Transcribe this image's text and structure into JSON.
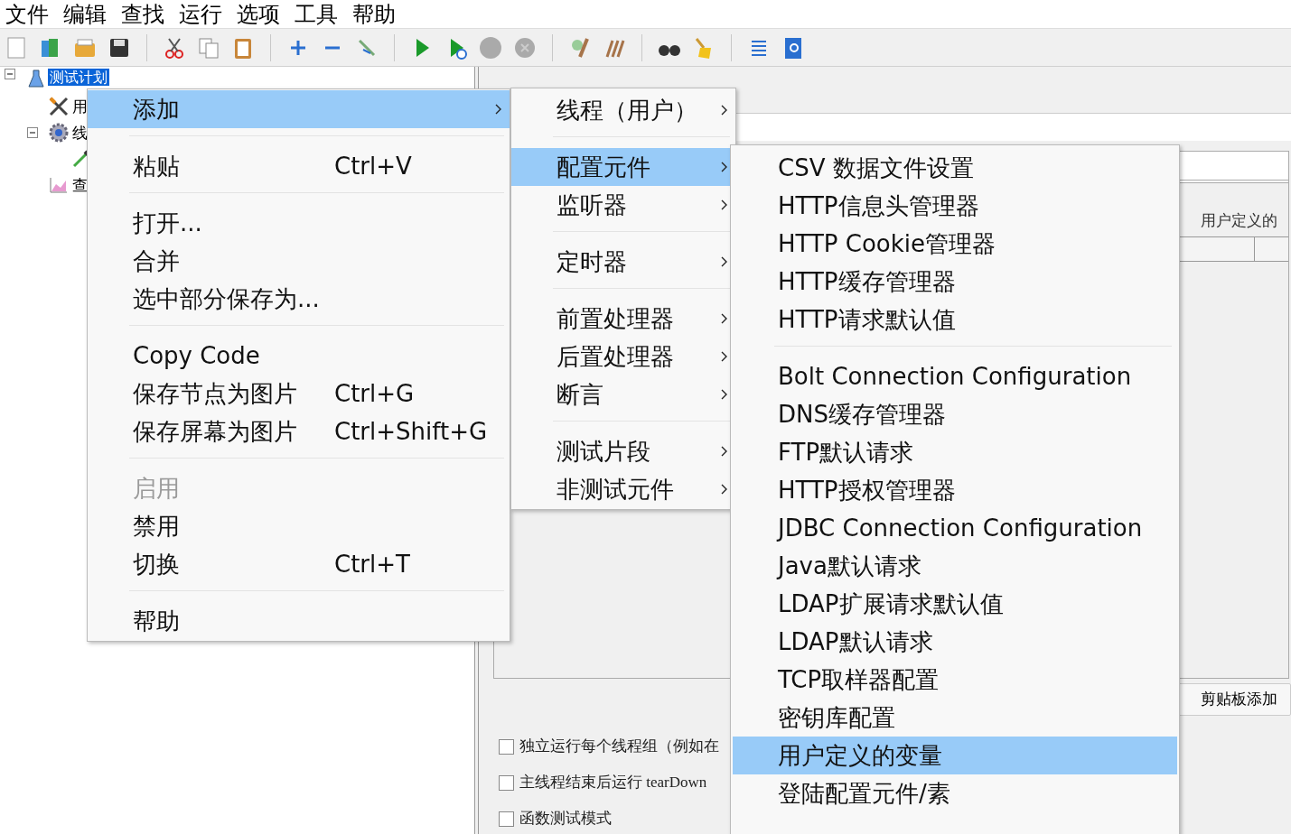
{
  "menubar": [
    {
      "label": "文件"
    },
    {
      "label": "编辑"
    },
    {
      "label": "查找"
    },
    {
      "label": "运行"
    },
    {
      "label": "选项"
    },
    {
      "label": "工具"
    },
    {
      "label": "帮助"
    }
  ],
  "tree": {
    "label": "测试计划",
    "kind": "plan",
    "selected": true,
    "expanded": true,
    "children": [
      {
        "label": "用",
        "kind": "config",
        "selected": false
      },
      {
        "label": "线",
        "kind": "thread_group",
        "selected": false,
        "expanded": true,
        "children": [
          {
            "kind": "sampler"
          }
        ]
      },
      {
        "label": "查",
        "kind": "listener",
        "selected": false
      }
    ]
  },
  "right_panel": {
    "table_header": "用户定义的",
    "clipboard_button": "剪贴板添加",
    "checkboxes": [
      {
        "label": "独立运行每个线程组（例如在",
        "checked": false
      },
      {
        "label": "主线程结束后运行 tearDown",
        "checked": false
      },
      {
        "label": "函数测试模式",
        "checked": false
      }
    ]
  },
  "context_menu": {
    "items": [
      {
        "kind": "item",
        "label": "添加",
        "selected": true,
        "submenu": true,
        "disabled": false
      },
      {
        "kind": "separator"
      },
      {
        "kind": "item",
        "label": "粘贴",
        "shortcut": "Ctrl+V",
        "selected": false,
        "submenu": false,
        "disabled": false
      },
      {
        "kind": "separator"
      },
      {
        "kind": "item",
        "label": "打开...",
        "selected": false,
        "submenu": false,
        "disabled": false
      },
      {
        "kind": "item",
        "label": "合并",
        "selected": false,
        "submenu": false,
        "disabled": false
      },
      {
        "kind": "item",
        "label": "选中部分保存为...",
        "selected": false,
        "submenu": false,
        "disabled": false
      },
      {
        "kind": "separator"
      },
      {
        "kind": "item",
        "label": "Copy Code",
        "selected": false,
        "submenu": false,
        "disabled": false
      },
      {
        "kind": "item",
        "label": "保存节点为图片",
        "shortcut": "Ctrl+G",
        "selected": false,
        "submenu": false,
        "disabled": false
      },
      {
        "kind": "item",
        "label": "保存屏幕为图片",
        "shortcut": "Ctrl+Shift+G",
        "selected": false,
        "submenu": false,
        "disabled": false
      },
      {
        "kind": "separator"
      },
      {
        "kind": "item",
        "label": "启用",
        "selected": false,
        "submenu": false,
        "disabled": true
      },
      {
        "kind": "item",
        "label": "禁用",
        "selected": false,
        "submenu": false,
        "disabled": false
      },
      {
        "kind": "item",
        "label": "切换",
        "shortcut": "Ctrl+T",
        "selected": false,
        "submenu": false,
        "disabled": false
      },
      {
        "kind": "separator"
      },
      {
        "kind": "item",
        "label": "帮助",
        "selected": false,
        "submenu": false,
        "disabled": false
      }
    ]
  },
  "add_submenu": {
    "items": [
      {
        "kind": "item",
        "label": "线程（用户）",
        "selected": false,
        "submenu": true
      },
      {
        "kind": "separator"
      },
      {
        "kind": "item",
        "label": "配置元件",
        "selected": true,
        "submenu": true
      },
      {
        "kind": "item",
        "label": "监听器",
        "selected": false,
        "submenu": true
      },
      {
        "kind": "separator"
      },
      {
        "kind": "item",
        "label": "定时器",
        "selected": false,
        "submenu": true
      },
      {
        "kind": "separator"
      },
      {
        "kind": "item",
        "label": "前置处理器",
        "selected": false,
        "submenu": true
      },
      {
        "kind": "item",
        "label": "后置处理器",
        "selected": false,
        "submenu": true
      },
      {
        "kind": "item",
        "label": "断言",
        "selected": false,
        "submenu": true
      },
      {
        "kind": "separator"
      },
      {
        "kind": "item",
        "label": "测试片段",
        "selected": false,
        "submenu": true
      },
      {
        "kind": "item",
        "label": "非测试元件",
        "selected": false,
        "submenu": true
      }
    ]
  },
  "config_submenu": {
    "items": [
      {
        "kind": "item",
        "label": "CSV 数据文件设置",
        "selected": false
      },
      {
        "kind": "item",
        "label": "HTTP信息头管理器",
        "selected": false
      },
      {
        "kind": "item",
        "label": "HTTP Cookie管理器",
        "selected": false
      },
      {
        "kind": "item",
        "label": "HTTP缓存管理器",
        "selected": false
      },
      {
        "kind": "item",
        "label": "HTTP请求默认值",
        "selected": false
      },
      {
        "kind": "separator"
      },
      {
        "kind": "item",
        "label": "Bolt Connection Configuration",
        "selected": false
      },
      {
        "kind": "item",
        "label": "DNS缓存管理器",
        "selected": false
      },
      {
        "kind": "item",
        "label": "FTP默认请求",
        "selected": false
      },
      {
        "kind": "item",
        "label": "HTTP授权管理器",
        "selected": false
      },
      {
        "kind": "item",
        "label": "JDBC Connection Configuration",
        "selected": false
      },
      {
        "kind": "item",
        "label": "Java默认请求",
        "selected": false
      },
      {
        "kind": "item",
        "label": "LDAP扩展请求默认值",
        "selected": false
      },
      {
        "kind": "item",
        "label": "LDAP默认请求",
        "selected": false
      },
      {
        "kind": "item",
        "label": "TCP取样器配置",
        "selected": false
      },
      {
        "kind": "item",
        "label": "密钥库配置",
        "selected": false
      },
      {
        "kind": "item",
        "label": "用户定义的变量",
        "selected": true
      },
      {
        "kind": "item",
        "label": "登陆配置元件/素",
        "selected": false
      }
    ]
  }
}
